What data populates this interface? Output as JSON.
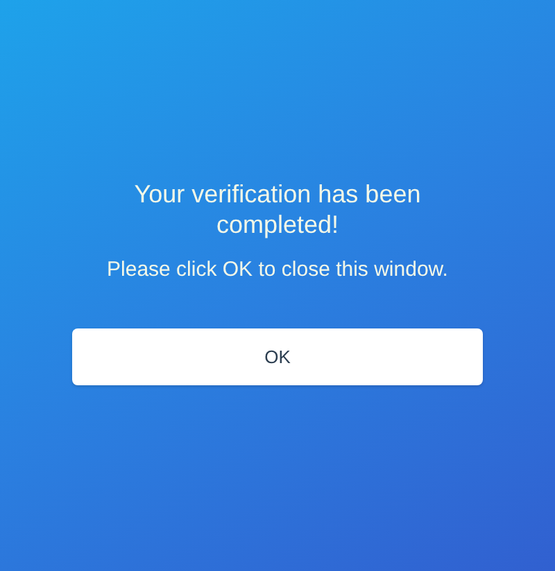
{
  "message": {
    "title": "Your verification has been completed!",
    "subtitle": "Please click OK to close this window."
  },
  "buttons": [
    "OK"
  ]
}
